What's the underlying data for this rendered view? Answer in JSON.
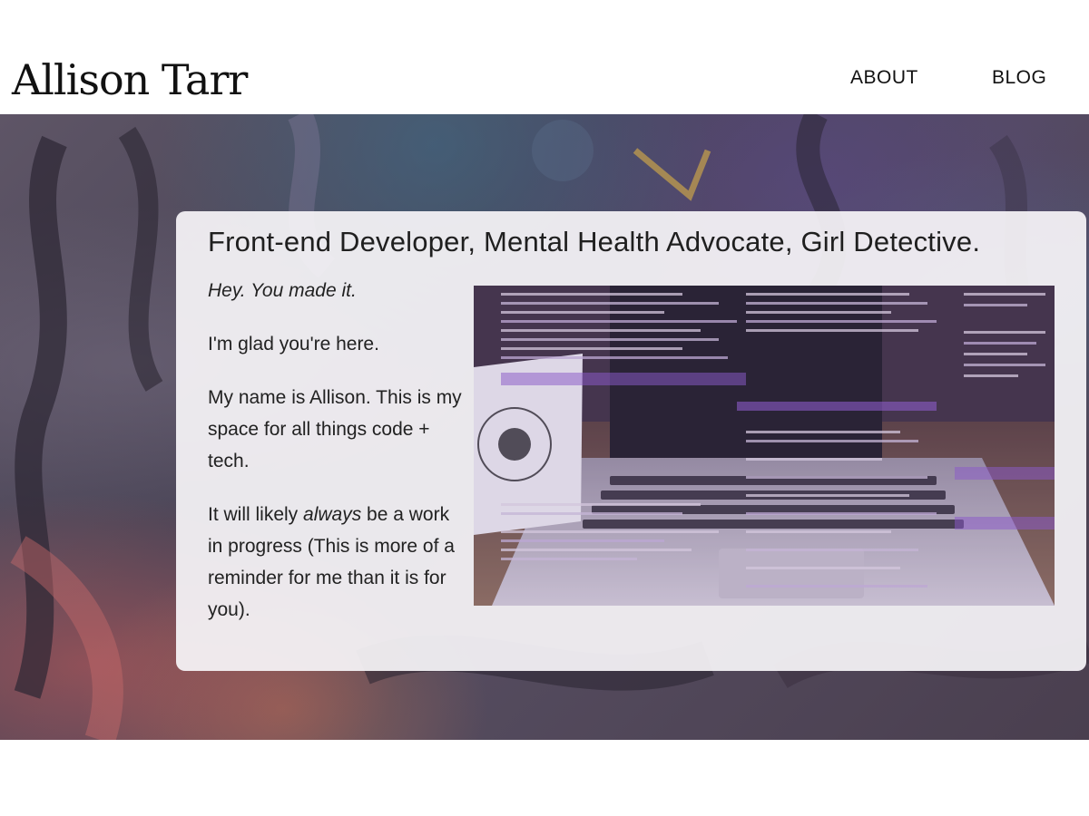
{
  "header": {
    "logo": "Allison Tarr",
    "nav": [
      {
        "label": "ABOUT"
      },
      {
        "label": "BLOG"
      }
    ]
  },
  "card": {
    "title": "Front-end Developer, Mental Health Advocate, Girl Detective.",
    "greeting": "Hey. You made it.",
    "glad": "I'm glad you're here.",
    "name_line": "My name is Allison. This is my space for all things code + tech.",
    "wip_before": "It will likely ",
    "wip_emphasis": "always",
    "wip_after": " be a work in progress (This is more of a reminder for me than it is for you)."
  },
  "colors": {
    "text": "#111111",
    "card_bg": "#f6f4f7"
  }
}
